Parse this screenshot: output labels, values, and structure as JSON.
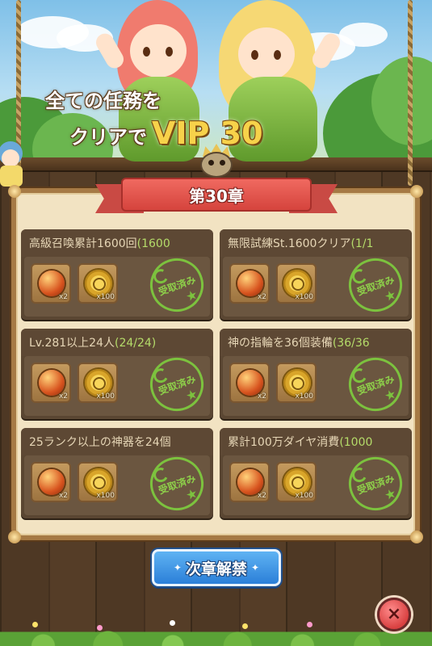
{
  "banner": {
    "line1": "全ての任務を",
    "line2": "クリアで",
    "vip": "VIP 30"
  },
  "chapter": {
    "title": "第30章"
  },
  "missions": [
    {
      "title": "高級召喚累計1600回",
      "progress": "(1600",
      "rewards": [
        {
          "icon": "fire-orb-icon",
          "qty": "x2"
        },
        {
          "icon": "gold-coin-icon",
          "qty": "x100"
        }
      ],
      "status": "受取済み"
    },
    {
      "title": "無限試練St.1600クリア",
      "progress": "(1/1",
      "rewards": [
        {
          "icon": "fire-orb-icon",
          "qty": "x2"
        },
        {
          "icon": "gold-coin-icon",
          "qty": "x100"
        }
      ],
      "status": "受取済み"
    },
    {
      "title": "Lv.281以上24人",
      "progress": "(24/24)",
      "rewards": [
        {
          "icon": "fire-orb-icon",
          "qty": "x2"
        },
        {
          "icon": "gold-coin-icon",
          "qty": "x100"
        }
      ],
      "status": "受取済み"
    },
    {
      "title": "神の指輪を36個装備",
      "progress": "(36/36",
      "rewards": [
        {
          "icon": "fire-orb-icon",
          "qty": "x2"
        },
        {
          "icon": "gold-coin-icon",
          "qty": "x100"
        }
      ],
      "status": "受取済み"
    },
    {
      "title": "25ランク以上の神器を24個",
      "progress": "",
      "rewards": [
        {
          "icon": "fire-orb-icon",
          "qty": "x2"
        },
        {
          "icon": "gold-coin-icon",
          "qty": "x100"
        }
      ],
      "status": "受取済み"
    },
    {
      "title": "累計100万ダイヤ消費",
      "progress": "(1000",
      "rewards": [
        {
          "icon": "fire-orb-icon",
          "qty": "x2"
        },
        {
          "icon": "gold-coin-icon",
          "qty": "x100"
        }
      ],
      "status": "受取済み"
    }
  ],
  "buttons": {
    "next_chapter": "次章解禁",
    "close": "×"
  },
  "colors": {
    "ribbon": "#d5443d",
    "stamp": "#7cc23e",
    "progress": "#b5dc6a",
    "next_button": "#2b7fd8",
    "close_button": "#d94141"
  }
}
